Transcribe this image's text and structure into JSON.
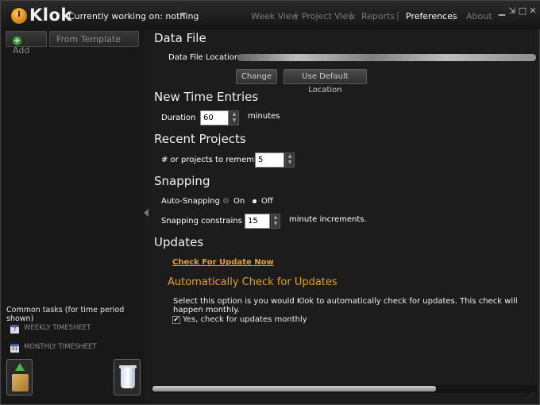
{
  "app": {
    "title": "Klok",
    "working_label": "Currently working on: nothing"
  },
  "nav": {
    "items": [
      {
        "label": "Week View",
        "active": false
      },
      {
        "label": "Project View",
        "active": false
      },
      {
        "label": "Reports",
        "active": false
      },
      {
        "label": "Preferences",
        "active": true
      },
      {
        "label": "About",
        "active": false
      }
    ],
    "window_controls": [
      "minimize-icon",
      "restore-icon",
      "close-icon"
    ]
  },
  "sidebar": {
    "add_label": "Add",
    "template_label": "From Template",
    "common_tasks_title": "Common tasks (for time period shown)",
    "tasks": [
      {
        "label": "WEEKLY TIMESHEET",
        "icon": "calendar-7-icon",
        "icon_text": "7"
      },
      {
        "label": "MONTHLY TIMESHEET",
        "icon": "calendar-31-icon",
        "icon_text": "31"
      }
    ]
  },
  "data_file": {
    "heading": "Data File",
    "location_label": "Data File Location",
    "change_label": "Change",
    "default_label": "Use Default Location"
  },
  "time_entries": {
    "heading": "New Time Entries",
    "duration_label": "Duration",
    "duration_value": "60",
    "unit": "minutes"
  },
  "recent_projects": {
    "heading": "Recent Projects",
    "remember_label": "# or projects to remember",
    "remember_value": "5"
  },
  "snapping": {
    "heading": "Snapping",
    "auto_label": "Auto-Snapping",
    "on_label": "On",
    "off_label": "Off",
    "selected": "Off",
    "constrain_label": "Snapping constrains to",
    "constrain_value": "15",
    "constrain_unit": "minute increments."
  },
  "updates": {
    "heading": "Updates",
    "check_now": "Check For Update Now",
    "auto_heading": "Automatically Check for Updates",
    "description": "Select this option is you would Klok to automatically check for updates. This check will happen monthly.",
    "checkbox_label": "Yes, check for updates monthly",
    "checked": true
  },
  "colors": {
    "accent": "#e5a11a",
    "background": "#1c1c1c"
  }
}
